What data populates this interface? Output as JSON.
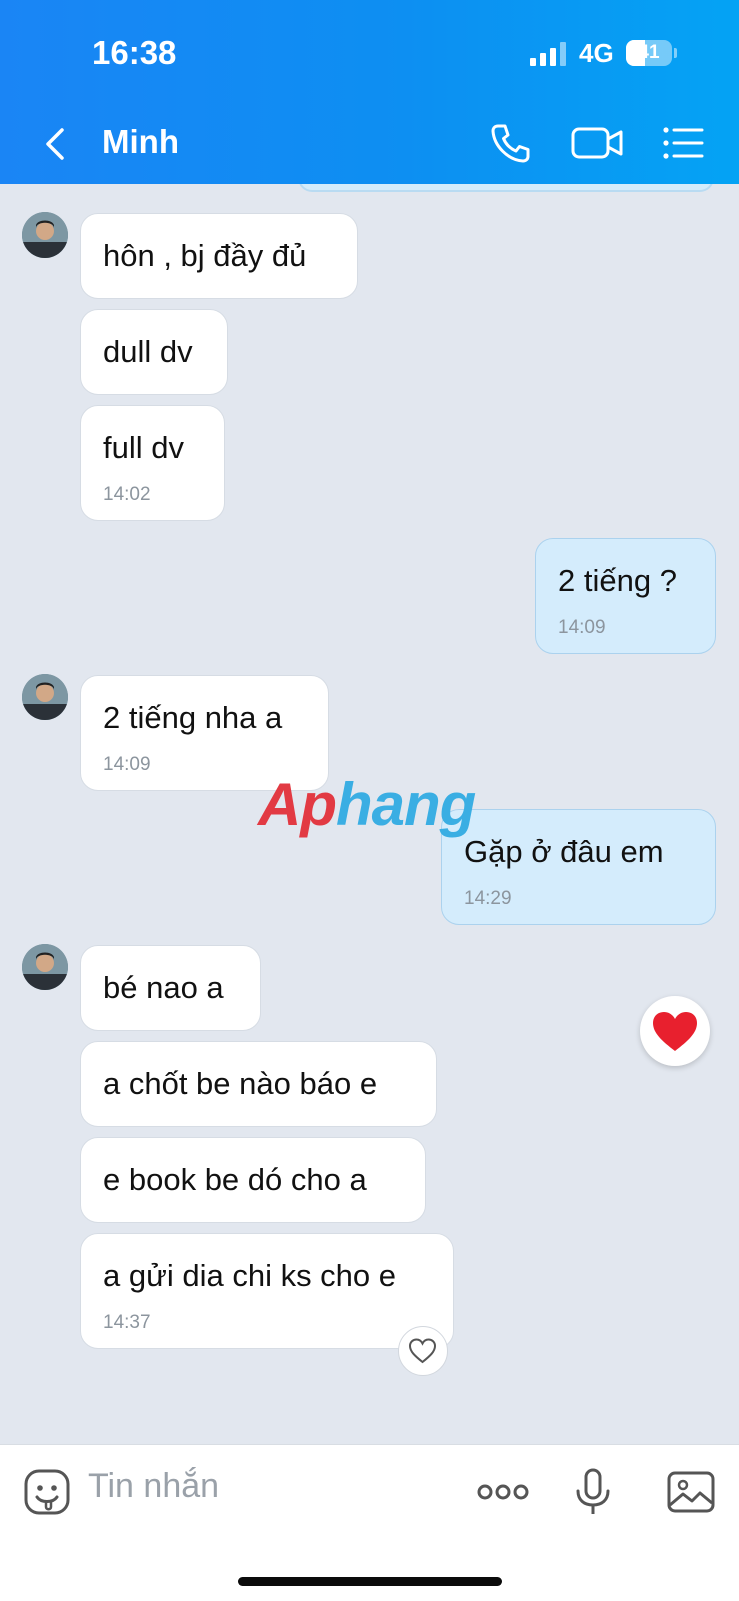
{
  "status_bar": {
    "time": "16:38",
    "network": "4G",
    "battery": "41",
    "battery_level": 0.41
  },
  "header": {
    "title": "Minh"
  },
  "messages": [
    {
      "side": "in",
      "text": "hôn , bj đầy đủ"
    },
    {
      "side": "in",
      "text": "dull dv"
    },
    {
      "side": "in",
      "text": "full dv",
      "time": "14:02"
    },
    {
      "side": "out",
      "text": "2 tiếng ?",
      "time": "14:09"
    },
    {
      "side": "in",
      "text": "2 tiếng nha a",
      "time": "14:09"
    },
    {
      "side": "out",
      "text": "Gặp ở đâu em",
      "time": "14:29"
    },
    {
      "side": "in",
      "text": "bé nao a"
    },
    {
      "side": "in",
      "text": "a chốt be nào báo e"
    },
    {
      "side": "in",
      "text": "e book be dó cho a"
    },
    {
      "side": "in",
      "text": "a gửi dia chi ks cho e",
      "time": "14:37"
    }
  ],
  "watermark": {
    "part1": "Ap",
    "part2": "hang"
  },
  "composer": {
    "placeholder": "Tin nhắn"
  },
  "colors": {
    "header": "#1a85f5",
    "incoming": "#ffffff",
    "outgoing": "#d4ecfc",
    "heart": "#e8202e"
  }
}
